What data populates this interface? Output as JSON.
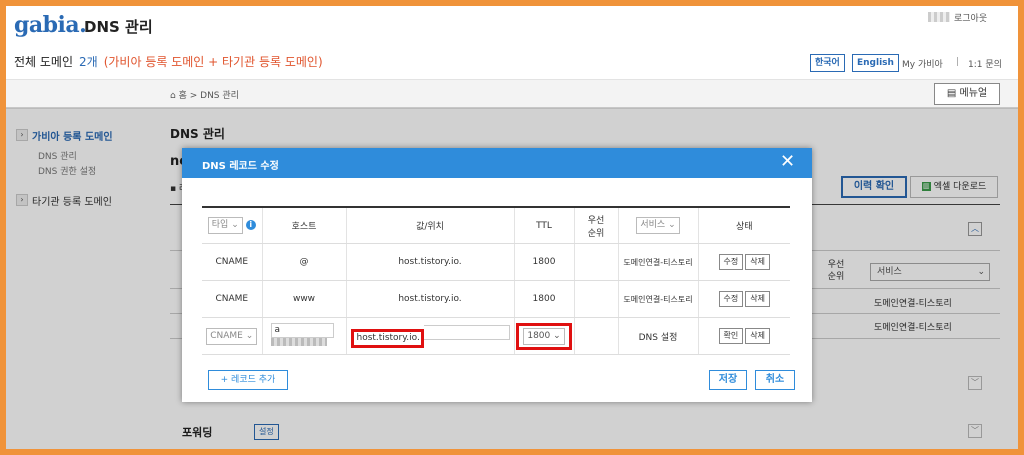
{
  "header": {
    "logo_text": "gabia.",
    "app_title": "DNS 관리",
    "logout": "로그아웃",
    "domain_label": "전체 도메인",
    "domain_count": "2개",
    "domain_desc": "(가비아 등록 도메인 + 타기관 등록 도메인)",
    "lang_ko": "한국어",
    "lang_en": "English",
    "mypage": "My 가비아",
    "separator": "|",
    "qna": "1:1 문의"
  },
  "breadcrumb": "홈 > DNS 관리",
  "manual_button": "메뉴얼",
  "sidebar": {
    "group1": "가비아 등록 도메인",
    "group1_items": [
      "DNS 관리",
      "DNS 권한 설정"
    ],
    "group2": "타기관 등록 도메인"
  },
  "main": {
    "title": "DNS 관리",
    "domain_fragment": "ne",
    "bullet_fragment": "▪ 레",
    "history_button": "이력 확인",
    "excel_button": "엑셀 다운로드",
    "excel_icon": "excel-icon",
    "priority_header": "우선\n순위",
    "service_select": "서비스",
    "row_values": [
      "도메인연결-티스토리",
      "도메인연결-티스토리"
    ],
    "forwarding_label": "포워딩",
    "forwarding_button": "설정"
  },
  "modal": {
    "title": "DNS 레코드 수정",
    "columns": {
      "type_select": "타입",
      "host": "호스트",
      "value": "값/위치",
      "ttl": "TTL",
      "priority": "우선\n순위",
      "service_select": "서비스",
      "status": "상태"
    },
    "rows": [
      {
        "type": "CNAME",
        "host": "@",
        "value": "host.tistory.io.",
        "ttl": "1800",
        "service": "도메인연결-티스토리",
        "btn1": "수정",
        "btn2": "삭제"
      },
      {
        "type": "CNAME",
        "host": "www",
        "value": "host.tistory.io.",
        "ttl": "1800",
        "service": "도메인연결-티스토리",
        "btn1": "수정",
        "btn2": "삭제"
      }
    ],
    "edit_row": {
      "type": "CNAME",
      "host": "a",
      "value": "host.tistory.io.",
      "ttl": "1800",
      "service": "DNS 설정",
      "btn1": "확인",
      "btn2": "삭제"
    },
    "add_record": "+ 레코드 추가",
    "save": "저장",
    "cancel": "취소"
  },
  "colors": {
    "accent": "#2f8cdb",
    "highlight": "#e01010",
    "border_frame": "#f0933a"
  }
}
